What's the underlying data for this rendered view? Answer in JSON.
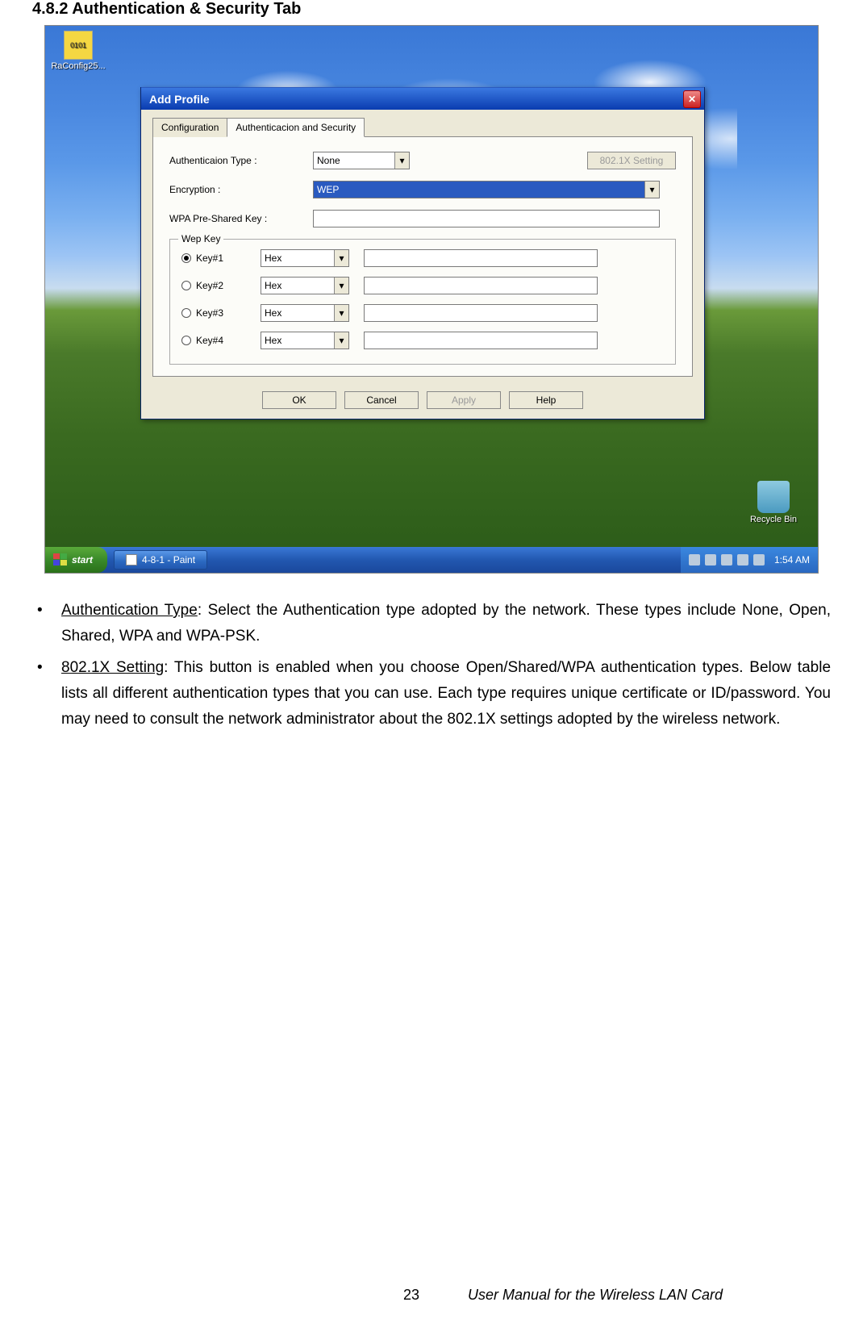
{
  "heading": "4.8.2 Authentication & Security Tab",
  "desktop": {
    "icon_label": "RaConfig25...",
    "recycle_label": "Recycle Bin"
  },
  "taskbar": {
    "start": "start",
    "task_item": "4-8-1 - Paint",
    "clock": "1:54 AM"
  },
  "dialog": {
    "title": "Add Profile",
    "tabs": {
      "config": "Configuration",
      "auth": "Authenticacion and Security"
    },
    "labels": {
      "auth_type": "Authenticaion Type :",
      "encryption": "Encryption :",
      "wpa_psk": "WPA Pre-Shared Key :",
      "wep_legend": "Wep Key"
    },
    "auth_type_value": "None",
    "encryption_value": "WEP",
    "btn_802": "802.1X Setting",
    "keys": [
      {
        "label": "Key#1",
        "format": "Hex",
        "checked": true
      },
      {
        "label": "Key#2",
        "format": "Hex",
        "checked": false
      },
      {
        "label": "Key#3",
        "format": "Hex",
        "checked": false
      },
      {
        "label": "Key#4",
        "format": "Hex",
        "checked": false
      }
    ],
    "actions": {
      "ok": "OK",
      "cancel": "Cancel",
      "apply": "Apply",
      "help": "Help"
    }
  },
  "bullets": [
    {
      "term": "Authentication Type",
      "rest": ": Select the Authentication type adopted by the network. These types include None, Open, Shared, WPA and WPA-PSK."
    },
    {
      "term": "802.1X Setting",
      "rest": ": This button is enabled when you choose Open/Shared/WPA authentication types. Below table lists all different authentication types that you can use. Each type requires unique certificate or ID/password. You may need to consult the network administrator about the 802.1X settings adopted by the wireless network."
    }
  ],
  "footer": {
    "page": "23",
    "title": "User Manual for the Wireless LAN Card"
  }
}
